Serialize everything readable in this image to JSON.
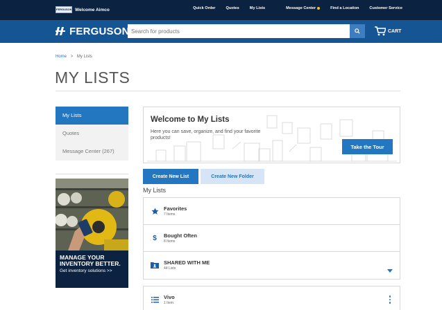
{
  "topbar": {
    "badge_text": "FERGUSON",
    "welcome": "Welcome Aimco",
    "links": [
      "Quick Order",
      "Quotes",
      "My Lists",
      "Message Center",
      "Find a Location",
      "Customer Service"
    ]
  },
  "header": {
    "logo": "FERGUSON",
    "search_placeholder": "Search for products",
    "cart_label": "CART"
  },
  "breadcrumb": {
    "home": "Home",
    "separator": ">",
    "current": "My Lists"
  },
  "page_title": "MY LISTS",
  "sidebar": {
    "items": [
      {
        "label": "My Lists",
        "active": true
      },
      {
        "label": "Quotes",
        "active": false
      },
      {
        "label": "Message Center (267)",
        "active": false
      }
    ]
  },
  "promo": {
    "headline": "MANAGE YOUR INVENTORY BETTER.",
    "sub": "Get inventory solutions >>"
  },
  "welcome_card": {
    "title": "Welcome to My Lists",
    "description": "Here you can save, organize, and find your favorite products!",
    "tour_button": "Take the Tour"
  },
  "actions": {
    "create_list": "Create New List",
    "create_folder": "Create New Folder"
  },
  "lists_section": {
    "label": "My Lists",
    "group1": [
      {
        "name": "Favorites",
        "count": "7 Items",
        "icon": "star-icon"
      },
      {
        "name": "Bought Often",
        "count": "8 Items",
        "icon": "dollar-icon"
      },
      {
        "name": "SHARED WITH ME",
        "count": "44 Lists",
        "icon": "shared-folder-icon"
      }
    ],
    "group2": [
      {
        "name": "Vivo",
        "count": "1 Item",
        "icon": "list-icon"
      }
    ]
  },
  "colors": {
    "topbar": "#0b2341",
    "header": "#165593",
    "accent": "#2376c0",
    "notification_dot": "#f7c20b"
  }
}
